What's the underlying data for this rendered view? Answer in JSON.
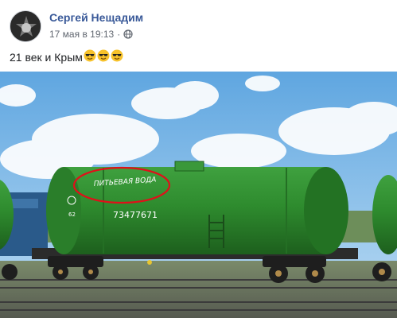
{
  "post": {
    "author_name": "Сергей Нещадим",
    "timestamp": "17 мая в 19:13",
    "separator": "·",
    "privacy_icon": "globe-icon",
    "text": "21 век и Крым",
    "emoji_icon": "smiling-face-with-sunglasses-icon",
    "emoji_count": 3
  },
  "photo": {
    "tank_label": "ПИТЬЕВАЯ ВОДА",
    "tank_number": "73477671",
    "marking_left": "62",
    "highlight_color": "#e0101a",
    "tank_color": "#2e8b2e",
    "sky_color": "#7fb8e6"
  }
}
